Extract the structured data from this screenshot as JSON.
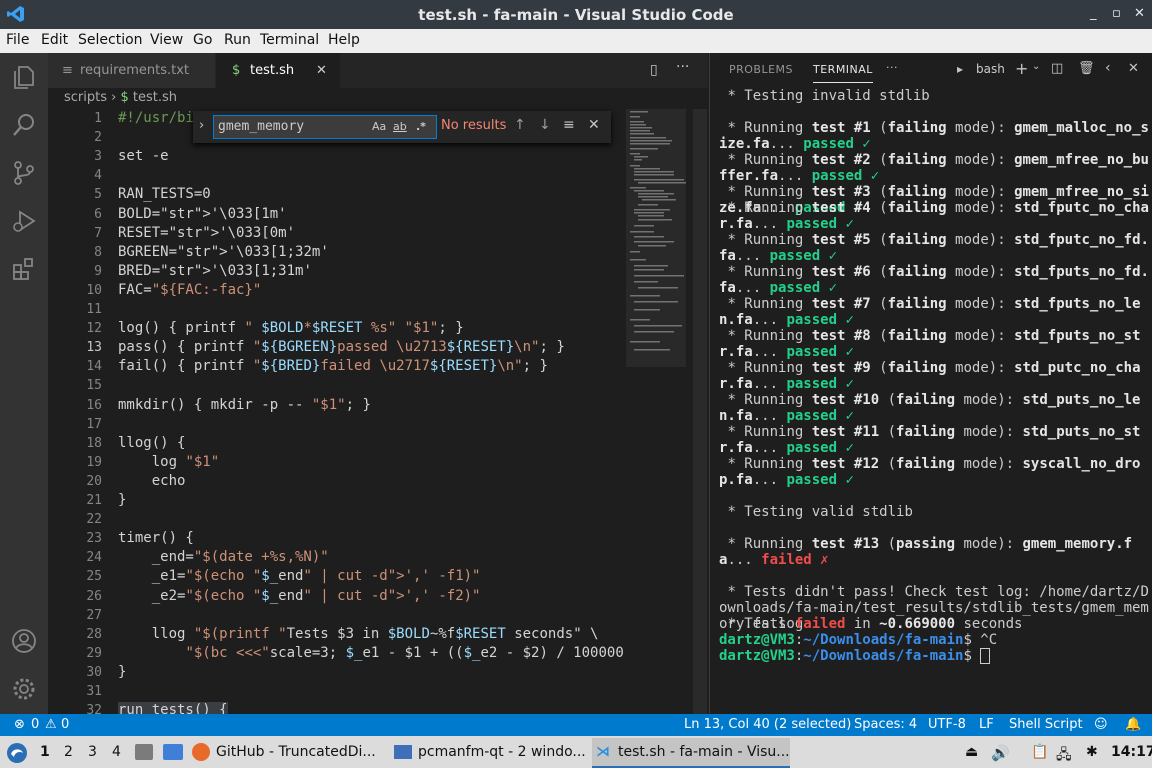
{
  "window": {
    "title": "test.sh - fa-main - Visual Studio Code"
  },
  "menu": [
    "File",
    "Edit",
    "Selection",
    "View",
    "Go",
    "Run",
    "Terminal",
    "Help"
  ],
  "tabs": [
    {
      "label": "requirements.txt"
    },
    {
      "label": "test.sh",
      "prefix": "$"
    }
  ],
  "breadcrumb": {
    "folder": "scripts",
    "file": "test.sh",
    "file_prefix": "$"
  },
  "find": {
    "value": "gmem_memory",
    "match_case": "Aa",
    "whole_word": "ab",
    "regex": ".*",
    "status": "No results"
  },
  "editor": {
    "lines": [
      {
        "n": "1",
        "text": "#!/usr/bi"
      },
      {
        "n": "2",
        "text": ""
      },
      {
        "n": "3",
        "text": "set -e"
      },
      {
        "n": "4",
        "text": ""
      },
      {
        "n": "5",
        "text": "RAN_TESTS=0"
      },
      {
        "n": "6",
        "text": "BOLD='\\033[1m'"
      },
      {
        "n": "7",
        "text": "RESET='\\033[0m'"
      },
      {
        "n": "8",
        "text": "BGREEN='\\033[1;32m'"
      },
      {
        "n": "9",
        "text": "BRED='\\033[1;31m'"
      },
      {
        "n": "10",
        "text": "FAC=\"${FAC:-fac}\""
      },
      {
        "n": "11",
        "text": ""
      },
      {
        "n": "12",
        "text": "log() { printf \" $BOLD*$RESET %s\" \"$1\"; }"
      },
      {
        "n": "13",
        "text": "pass() { printf \"${BGREEN}passed \\u2713${RESET}\\n\"; }"
      },
      {
        "n": "14",
        "text": "fail() { printf \"${BRED}failed \\u2717${RESET}\\n\"; }"
      },
      {
        "n": "15",
        "text": ""
      },
      {
        "n": "16",
        "text": "mmkdir() { mkdir -p -- \"$1\"; }"
      },
      {
        "n": "17",
        "text": ""
      },
      {
        "n": "18",
        "text": "llog() {"
      },
      {
        "n": "19",
        "text": "    log \"$1\""
      },
      {
        "n": "20",
        "text": "    echo"
      },
      {
        "n": "21",
        "text": "}"
      },
      {
        "n": "22",
        "text": ""
      },
      {
        "n": "23",
        "text": "timer() {"
      },
      {
        "n": "24",
        "text": "    _end=\"$(date +%s,%N)\""
      },
      {
        "n": "25",
        "text": "    _e1=\"$(echo \"$_end\" | cut -d',' -f1)\""
      },
      {
        "n": "26",
        "text": "    _e2=\"$(echo \"$_end\" | cut -d',' -f2)\""
      },
      {
        "n": "27",
        "text": ""
      },
      {
        "n": "28",
        "text": "    llog \"$(printf \"Tests $3 in $BOLD~%f$RESET seconds\" \\"
      },
      {
        "n": "29",
        "text": "        \"$(bc <<<\"scale=3; $_e1 - $1 + (($_e2 - $2) / 100000"
      },
      {
        "n": "30",
        "text": "}"
      },
      {
        "n": "31",
        "text": ""
      },
      {
        "n": "32",
        "text": "run_tests() {"
      }
    ]
  },
  "panel": {
    "tabs": [
      "PROBLEMS",
      "TERMINAL",
      "···"
    ],
    "shell": "bash",
    "terminal": [
      " * Testing invalid stdlib",
      "",
      " * Running test #1 (failing mode): gmem_malloc_no_size.fa... passed ✓",
      " * Running test #2 (failing mode): gmem_mfree_no_buffer.fa... passed ✓",
      " * Running test #3 (failing mode): gmem_mfree_no_size.fa... passed ✓",
      " * Running test #4 (failing mode): std_fputc_no_char.fa... passed ✓",
      " * Running test #5 (failing mode): std_fputc_no_fd.fa... passed ✓",
      " * Running test #6 (failing mode): std_fputs_no_fd.fa... passed ✓",
      " * Running test #7 (failing mode): std_fputs_no_len.fa... passed ✓",
      " * Running test #8 (failing mode): std_fputs_no_str.fa... passed ✓",
      " * Running test #9 (failing mode): std_putc_no_char.fa... passed ✓",
      " * Running test #10 (failing mode): std_puts_no_len.fa... passed ✓",
      " * Running test #11 (failing mode): std_puts_no_str.fa... passed ✓",
      " * Running test #12 (failing mode): syscall_no_drop.fa... passed ✓",
      "",
      " * Testing valid stdlib",
      "",
      " * Running test #13 (passing mode): gmem_memory.fa... failed ✗",
      "",
      " * Tests didn't pass! Check test log: /home/dartz/Downloads/fa-main/test_results/stdlib_tests/gmem_memory.fa.log",
      " * Tests failed in ~0.669000 seconds",
      "dartz@VM3:~/Downloads/fa-main$ ^C",
      "dartz@VM3:~/Downloads/fa-main$ "
    ]
  },
  "statusbar": {
    "errors": "0",
    "warnings": "0",
    "position": "Ln 13, Col 40 (2 selected)",
    "spaces": "Spaces: 4",
    "encoding": "UTF-8",
    "eol": "LF",
    "language": "Shell Script"
  },
  "taskbar": {
    "workspaces": [
      "1",
      "2",
      "3",
      "4"
    ],
    "tasks": [
      "GitHub - TruncatedDi...",
      "pcmanfm-qt - 2 windo...",
      "test.sh - fa-main - Visu..."
    ],
    "clock": "14:17"
  },
  "colors": {
    "accent": "#007acc",
    "passed": "#23d18b",
    "failed": "#f14c4c",
    "prompt_path": "#3b8eea"
  }
}
